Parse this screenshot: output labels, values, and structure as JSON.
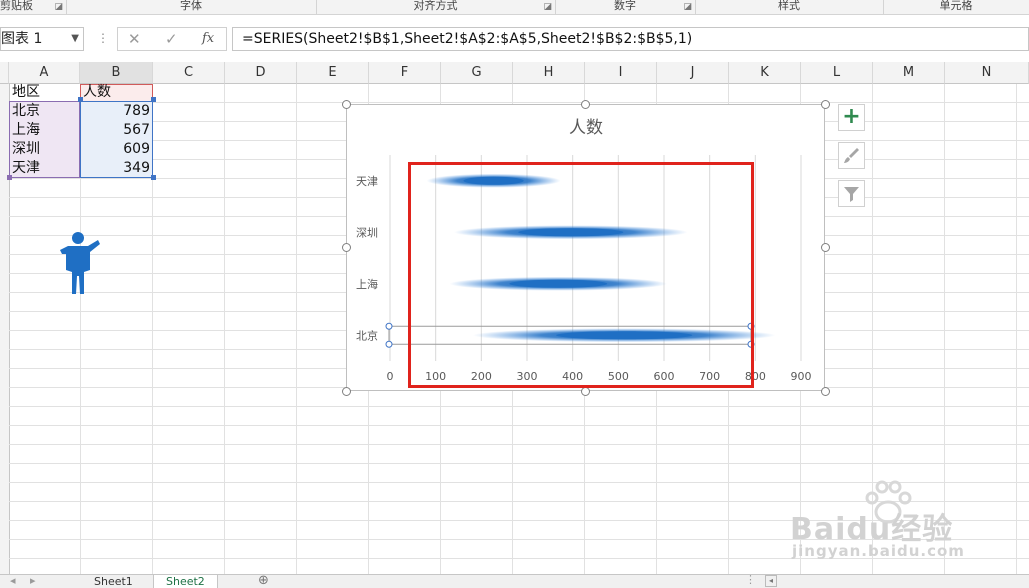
{
  "ribbon": {
    "groups": [
      "剪贴板",
      "字体",
      "对齐方式",
      "数字",
      "样式",
      "单元格"
    ]
  },
  "formula_bar": {
    "name_box": "图表 1",
    "cancel_icon": "✕",
    "enter_icon": "✓",
    "fx_icon": "fx",
    "formula": "=SERIES(Sheet2!$B$1,Sheet2!$A$2:$A$5,Sheet2!$B$2:$B$5,1)"
  },
  "columns": [
    "A",
    "B",
    "C",
    "D",
    "E",
    "F",
    "G",
    "H",
    "I",
    "J",
    "K",
    "L",
    "M",
    "N"
  ],
  "table": {
    "headers": [
      "地区",
      "人数"
    ],
    "rows": [
      {
        "region": "北京",
        "count": "789"
      },
      {
        "region": "上海",
        "count": "567"
      },
      {
        "region": "深圳",
        "count": "609"
      },
      {
        "region": "天津",
        "count": "349"
      }
    ]
  },
  "chart_data": {
    "type": "bar",
    "orientation": "horizontal",
    "title": "人数",
    "categories": [
      "北京",
      "上海",
      "深圳",
      "天津"
    ],
    "values": [
      789,
      567,
      609,
      349
    ],
    "xlim": [
      0,
      900
    ],
    "xticks": [
      0,
      100,
      200,
      300,
      400,
      500,
      600,
      700,
      800,
      900
    ],
    "grid": "vertical",
    "bar_color": "#1f6fc4",
    "selected_category": "北京"
  },
  "side_buttons": {
    "add_icon": "+"
  },
  "sheet_tabs": [
    "Sheet1",
    "Sheet2"
  ],
  "colors": {
    "accent_green": "#217346",
    "selection_blue": "#3f74c6",
    "highlight_red": "#e0231c"
  },
  "watermark": {
    "brand": "Baidu经验",
    "url": "jingyan.baidu.com"
  }
}
